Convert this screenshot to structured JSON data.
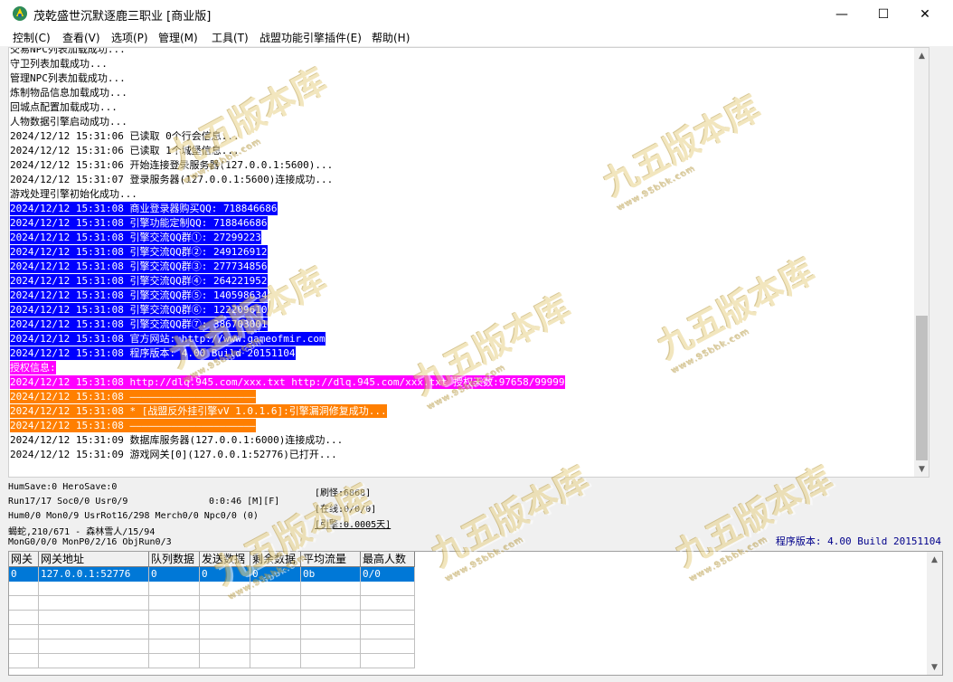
{
  "window": {
    "title": "茂乾盛世沉默逐鹿三职业 [商业版]",
    "minimize": "—",
    "maximize": "☐",
    "close": "✕",
    "icon": "app-icon"
  },
  "menu": [
    "控制(C)",
    "查看(V)",
    "选项(P)",
    "管理(M)",
    "工具(T)",
    "战盟功能引擎插件(E)",
    "帮助(H)"
  ],
  "log": {
    "lines": [
      {
        "text": "交易NPC列表加载成功...",
        "bg": "",
        "fg": "#000000"
      },
      {
        "text": "守卫列表加载成功...",
        "bg": "",
        "fg": "#000000"
      },
      {
        "text": "管理NPC列表加载成功...",
        "bg": "",
        "fg": "#000000"
      },
      {
        "text": "炼制物品信息加载成功...",
        "bg": "",
        "fg": "#000000"
      },
      {
        "text": "回城点配置加载成功...",
        "bg": "",
        "fg": "#000000"
      },
      {
        "text": "人物数据引擎启动成功...",
        "bg": "",
        "fg": "#000000"
      },
      {
        "text": "2024/12/12 15:31:06 已读取 0个行会信息...",
        "bg": "",
        "fg": "#000000"
      },
      {
        "text": "2024/12/12 15:31:06 已读取 1个城堡信息...",
        "bg": "",
        "fg": "#000000"
      },
      {
        "text": "2024/12/12 15:31:06 开始连接登录服务器(127.0.0.1:5600)...",
        "bg": "",
        "fg": "#000000"
      },
      {
        "text": "2024/12/12 15:31:07 登录服务器(127.0.0.1:5600)连接成功...",
        "bg": "",
        "fg": "#000000"
      },
      {
        "text": "游戏处理引擎初始化成功...",
        "bg": "",
        "fg": "#000000"
      },
      {
        "text": "2024/12/12 15:31:08 商业登录器购买QQ: 718846686",
        "bg": "#0000ff",
        "fg": "#ffffff"
      },
      {
        "text": "2024/12/12 15:31:08 引擎功能定制QQ: 718846686",
        "bg": "#0000ff",
        "fg": "#ffffff"
      },
      {
        "text": "2024/12/12 15:31:08 引擎交流QQ群①: 27299223",
        "bg": "#0000ff",
        "fg": "#ffffff"
      },
      {
        "text": "2024/12/12 15:31:08 引擎交流QQ群②: 249126912",
        "bg": "#0000ff",
        "fg": "#ffffff"
      },
      {
        "text": "2024/12/12 15:31:08 引擎交流QQ群③: 277734856",
        "bg": "#0000ff",
        "fg": "#ffffff"
      },
      {
        "text": "2024/12/12 15:31:08 引擎交流QQ群④: 264221952",
        "bg": "#0000ff",
        "fg": "#ffffff"
      },
      {
        "text": "2024/12/12 15:31:08 引擎交流QQ群⑤: 140598634",
        "bg": "#0000ff",
        "fg": "#ffffff"
      },
      {
        "text": "2024/12/12 15:31:08 引擎交流QQ群⑥: 122209610",
        "bg": "#0000ff",
        "fg": "#ffffff"
      },
      {
        "text": "2024/12/12 15:31:08 引擎交流QQ群⑦: 386703001",
        "bg": "#0000ff",
        "fg": "#ffffff"
      },
      {
        "text": "2024/12/12 15:31:08 官方网站: http://www.gameofmir.com",
        "bg": "#0000ff",
        "fg": "#ffffff"
      },
      {
        "text": "2024/12/12 15:31:08 程序版本: 4.00 Build 20151104",
        "bg": "#0000ff",
        "fg": "#ffffff"
      },
      {
        "text": "授权信息:",
        "bg": "#ff00ff",
        "fg": "#ffffff"
      },
      {
        "text": "2024/12/12 15:31:08 http://dlq.945.com/xxx.txt http://dlq.945.com/xxx.txt 授权天数:97658/99999",
        "bg": "#ff00ff",
        "fg": "#ffffff"
      },
      {
        "text": "2024/12/12 15:31:08 —————————————————————",
        "bg": "#ff7f00",
        "fg": "#ffffff"
      },
      {
        "text": "2024/12/12 15:31:08 * [战盟反外挂引擎vV 1.0.1.6]:引擎漏洞修复成功...",
        "bg": "#ff7f00",
        "fg": "#ffffff"
      },
      {
        "text": "2024/12/12 15:31:08 —————————————————————",
        "bg": "#ff7f00",
        "fg": "#ffffff"
      },
      {
        "text": "2024/12/12 15:31:09 数据库服务器(127.0.0.1:6000)连接成功...",
        "bg": "",
        "fg": "#000000"
      },
      {
        "text": "2024/12/12 15:31:09 游戏网关[0](127.0.0.1:52776)已打开...",
        "bg": "",
        "fg": "#000000"
      }
    ]
  },
  "status": {
    "humsave": "HumSave:0 HeroSave:0",
    "run": "Run17/17 Soc0/0 Usr0/9",
    "time": "0:0:46 [M][F]",
    "hum": "Hum0/0 Mon0/9 UsrRot16/298 Merch0/0 Npc0/0 (0)",
    "monster": "蝎蛇,210/671 - 森林雪人/15/94",
    "mongo": "MonG0/0/0 MonP0/2/16 ObjRun0/3",
    "refresh": "[刷怪:6868]",
    "online": "[在线:0/0/0]",
    "engine": "[引擎:0.0005天]",
    "version": "程序版本: 4.00 Build 20151104"
  },
  "gateway_table": {
    "headers": [
      "网关",
      "网关地址",
      "队列数据",
      "发送数据",
      "剩余数据",
      "平均流量",
      "最高人数"
    ],
    "rows": [
      [
        "0",
        "127.0.0.1:52776",
        "0",
        "0",
        "0",
        "0b",
        "0/0"
      ]
    ],
    "selected_row_color": "#0078d7"
  },
  "watermark": {
    "text": "九五版本库",
    "url": "www.95bbk.com"
  }
}
